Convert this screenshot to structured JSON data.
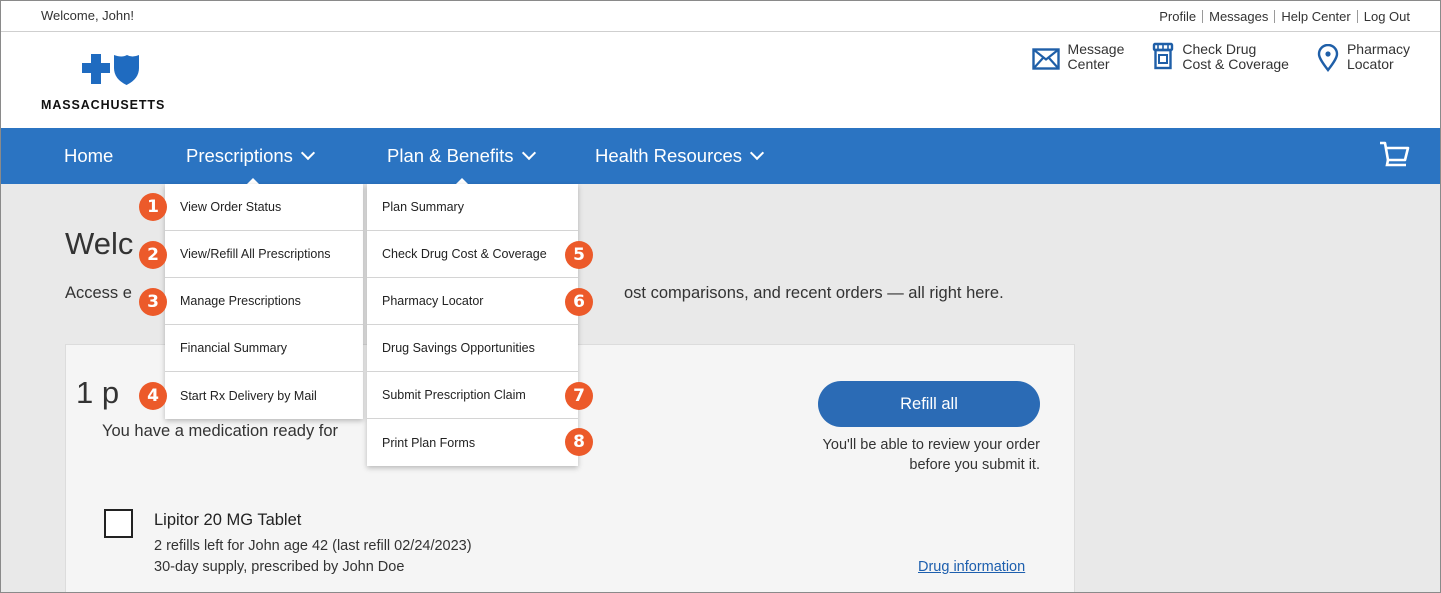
{
  "utility": {
    "welcome": "Welcome, John!",
    "links": [
      "Profile",
      "Messages",
      "Help Center",
      "Log Out"
    ]
  },
  "logo": {
    "wordmark": "MASSACHUSETTS"
  },
  "header_icons": [
    {
      "icon": "envelope-icon",
      "label": "Message\nCenter"
    },
    {
      "icon": "pill-bottle-icon",
      "label": "Check Drug\nCost & Coverage"
    },
    {
      "icon": "map-pin-icon",
      "label": "Pharmacy\nLocator"
    }
  ],
  "nav": {
    "home": "Home",
    "prescriptions": "Prescriptions",
    "plan_benefits": "Plan & Benefits",
    "health_resources": "Health Resources",
    "cart_icon": "cart-icon"
  },
  "prescriptions_menu": [
    {
      "label": "View Order Status",
      "badge": "1"
    },
    {
      "label": "View/Refill All Prescriptions",
      "badge": "2"
    },
    {
      "label": "Manage Prescriptions",
      "badge": "3"
    },
    {
      "label": "Financial Summary",
      "badge": ""
    },
    {
      "label": "Start Rx Delivery by Mail",
      "badge": "4"
    }
  ],
  "plan_menu": [
    {
      "label": "Plan Summary",
      "badge": ""
    },
    {
      "label": "Check Drug Cost & Coverage",
      "badge": "5"
    },
    {
      "label": "Pharmacy Locator",
      "badge": "6"
    },
    {
      "label": "Drug Savings Opportunities",
      "badge": ""
    },
    {
      "label": "Submit Prescription Claim",
      "badge": "7"
    },
    {
      "label": "Print Plan Forms",
      "badge": "8"
    }
  ],
  "page": {
    "title_visible": "Welc",
    "subtitle_left": "Access e",
    "subtitle_right": "ost comparisons, and recent orders — all right here."
  },
  "card": {
    "count_visible": "1 p",
    "ready_visible": "You have a medication ready for",
    "refill_button": "Refill all",
    "refill_note": "You'll be able to review your order before you submit it.",
    "drug": {
      "name": "Lipitor 20 MG Tablet",
      "line1": "2 refills left for John age 42 (last refill 02/24/2023)",
      "line2": "30-day supply, prescribed by John Doe",
      "info_link": "Drug information"
    }
  },
  "colors": {
    "nav_blue": "#2b74c2",
    "badge_orange": "#ec5a2a",
    "button_blue": "#2b6bb5",
    "link_blue": "#1d5fae"
  }
}
